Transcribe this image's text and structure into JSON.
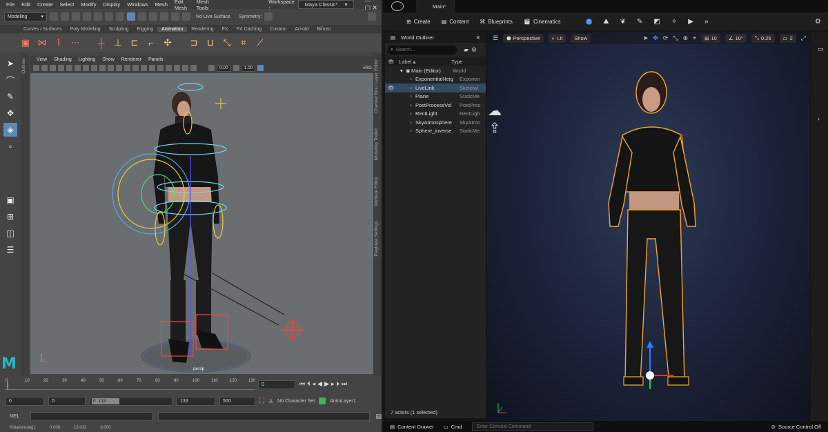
{
  "maya": {
    "menubar": [
      "File",
      "Edit",
      "Create",
      "Select",
      "Modify",
      "Display",
      "Windows",
      "Mesh",
      "Edit Mesh",
      "Mesh Tools"
    ],
    "mode_select": "Modeling",
    "live_surface": "No Live Surface",
    "symmetry_label": "Symmetry:",
    "workspace_label": "Workspace :",
    "workspace_value": "Maya Classic*",
    "shelf_tabs": [
      "Curves / Surfaces",
      "Poly Modeling",
      "Sculpting",
      "Rigging",
      "Animation",
      "Rendering",
      "FX",
      "FX Caching",
      "Custom",
      "Arnold",
      "Bifrost"
    ],
    "active_shelf": "Animation",
    "outliner_tab": "Outliner",
    "viewport_menus": [
      "View",
      "Shading",
      "Lighting",
      "Show",
      "Renderer",
      "Panels"
    ],
    "viewport_values": {
      "exposure": "0.00",
      "gamma": "1.00",
      "colorspace": "sRG"
    },
    "camera_label": "persp",
    "side_tabs": [
      "Channel Box / Layer Editor",
      "Modeling Toolkit",
      "Attribute Editor",
      "Playblast Settings"
    ],
    "timeline_ticks": [
      "0",
      "10",
      "20",
      "30",
      "40",
      "50",
      "60",
      "70",
      "80",
      "90",
      "100",
      "110",
      "120",
      "130"
    ],
    "current_frame": "0",
    "range": {
      "start": "0",
      "inner_start": "0",
      "slider_start": "0",
      "slider_end": "133",
      "end": "133",
      "outer_end": "500"
    },
    "character_set": "No Character Set",
    "anim_layer": "AnimLayer1",
    "cmd_label": "MEL",
    "help_line": [
      "Rotation(deg):",
      "0.000",
      "13.032",
      "0.000"
    ],
    "logo": "M"
  },
  "unreal": {
    "tab_title": "Main*",
    "toolbar": [
      "Create",
      "Content",
      "Blueprints",
      "Cinematics"
    ],
    "outliner": {
      "tab_title": "World Outliner",
      "search_placeholder": "Search...",
      "col_label": "Label",
      "col_type": "Type",
      "rows": [
        {
          "label": "Main (Editor)",
          "type": "World",
          "indent": 1,
          "selected": false
        },
        {
          "label": "ExponentialHeig",
          "type": "Exponen",
          "indent": 2,
          "selected": false
        },
        {
          "label": "LiveLink",
          "type": "Skeletal",
          "indent": 2,
          "selected": true
        },
        {
          "label": "Plane",
          "type": "StaticMe",
          "indent": 2,
          "selected": false
        },
        {
          "label": "PostProcessVol",
          "type": "PostProc",
          "indent": 2,
          "selected": false
        },
        {
          "label": "RectLight",
          "type": "RectLigh",
          "indent": 2,
          "selected": false
        },
        {
          "label": "SkyAtmosphere",
          "type": "SkyAtmo",
          "indent": 2,
          "selected": false
        },
        {
          "label": "Sphere_inverse",
          "type": "StaticMe",
          "indent": 2,
          "selected": false
        }
      ],
      "status": "7 actors (1 selected)"
    },
    "viewport": {
      "perspective": "Perspective",
      "lit": "Lit",
      "show": "Show",
      "grid_snap": "10",
      "rot_snap": "10°",
      "scale_snap": "0.25",
      "cam_speed": "2"
    },
    "bottom": {
      "content_drawer": "Content Drawer",
      "cmd": "Cmd",
      "console_placeholder": "Enter Console Command",
      "source_control": "Source Control Off"
    }
  }
}
